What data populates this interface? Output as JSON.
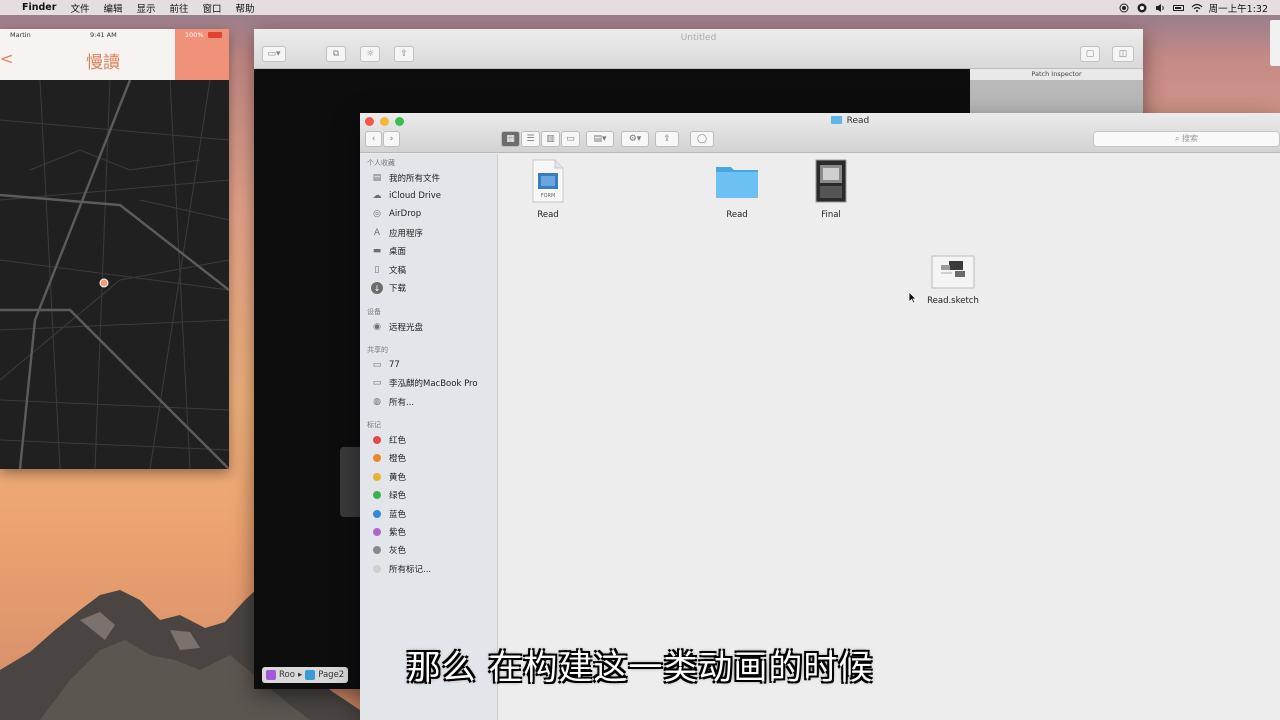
{
  "menubar": {
    "app": "Finder",
    "items": [
      "文件",
      "编辑",
      "显示",
      "前往",
      "窗口",
      "帮助"
    ],
    "clock": "周一上午1:32"
  },
  "phone": {
    "carrier": "Martin",
    "time": "9:41 AM",
    "battery": "100%",
    "nav_title": "慢讀",
    "back_glyph": "<"
  },
  "origami": {
    "title": "Untitled",
    "inspector_title": "Patch Inspector",
    "breadcrumb_root": "Roo",
    "breadcrumb_page": "Page2"
  },
  "finder": {
    "title": "Read",
    "search_placeholder": "搜索",
    "sidebar": {
      "favorites_header": "个人收藏",
      "favorites": [
        {
          "label": "我的所有文件",
          "icon": "all-files-icon"
        },
        {
          "label": "iCloud Drive",
          "icon": "cloud-icon"
        },
        {
          "label": "AirDrop",
          "icon": "airdrop-icon"
        },
        {
          "label": "应用程序",
          "icon": "applications-icon"
        },
        {
          "label": "桌面",
          "icon": "desktop-icon"
        },
        {
          "label": "文稿",
          "icon": "documents-icon"
        },
        {
          "label": "下载",
          "icon": "downloads-icon"
        }
      ],
      "devices_header": "设备",
      "devices": [
        {
          "label": "远程光盘",
          "icon": "disc-icon"
        }
      ],
      "shared_header": "共享的",
      "shared": [
        {
          "label": "77",
          "icon": "display-icon"
        },
        {
          "label": "李泓麒的MacBook Pro",
          "icon": "laptop-icon"
        },
        {
          "label": "所有...",
          "icon": "network-icon"
        }
      ],
      "tags_header": "标记",
      "tags": [
        {
          "label": "红色",
          "color": "#e5484d"
        },
        {
          "label": "橙色",
          "color": "#f0862b"
        },
        {
          "label": "黄色",
          "color": "#e3b52b"
        },
        {
          "label": "绿色",
          "color": "#3fb04a"
        },
        {
          "label": "蓝色",
          "color": "#3a86d8"
        },
        {
          "label": "紫色",
          "color": "#b065c9"
        },
        {
          "label": "灰色",
          "color": "#8a8a8a"
        },
        {
          "label": "所有标记...",
          "color": "#cfcfcf"
        }
      ]
    },
    "files": [
      {
        "name": "Read",
        "icon": "form-document-icon"
      },
      {
        "name": "Read",
        "icon": "folder-icon"
      },
      {
        "name": "Final",
        "icon": "image-thumbnail-icon"
      },
      {
        "name": "Read.sketch",
        "icon": "sketch-file-icon"
      }
    ]
  },
  "subtitle": "那么  在构建这一类动画的时候",
  "colors": {
    "accent": "#e0805a",
    "folder_blue": "#5fb4e8",
    "selection": "#6c6c6c"
  }
}
